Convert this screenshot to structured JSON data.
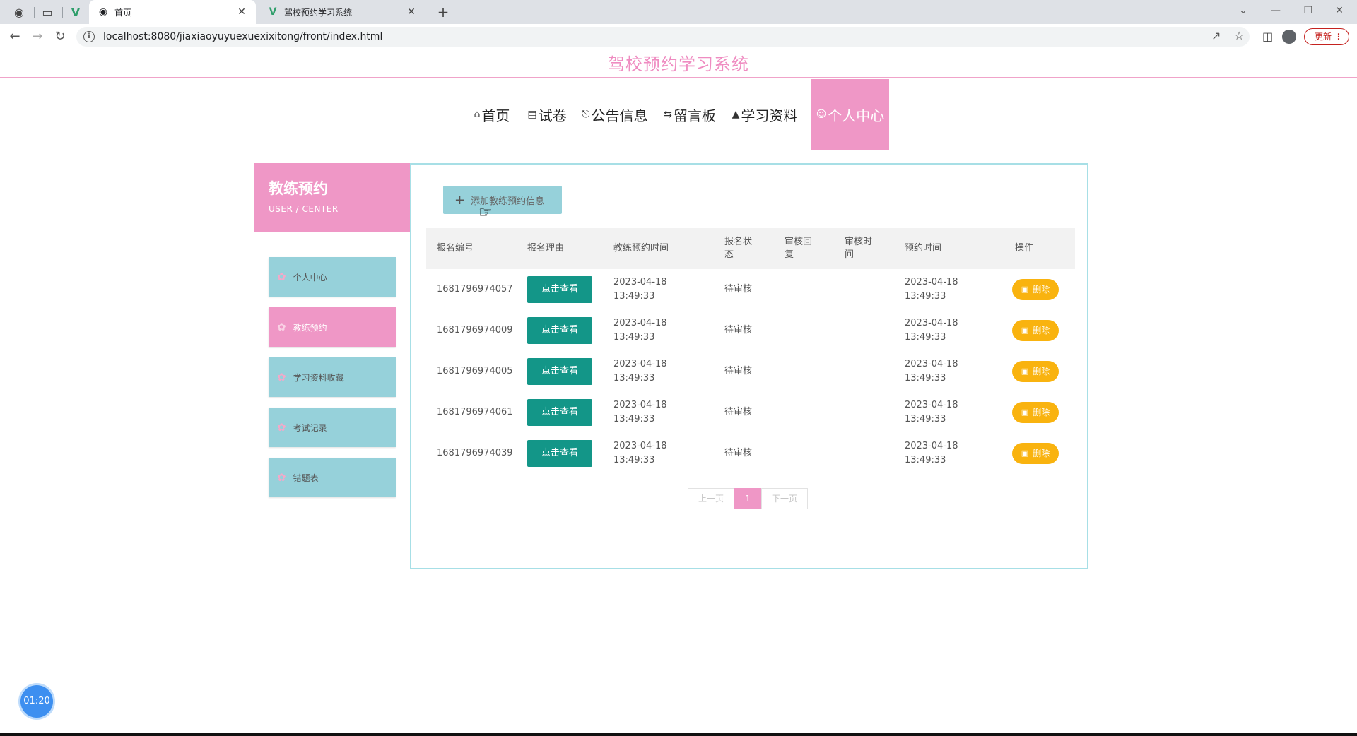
{
  "browser": {
    "tabs": [
      {
        "title": "首页",
        "active": true
      },
      {
        "title": "驾校预约学习系统",
        "active": false
      }
    ],
    "url": "localhost:8080/jiaxiaoyuyuexuexixitong/front/index.html",
    "update_label": "更新"
  },
  "site": {
    "title": "驾校预约学习系统",
    "nav": [
      {
        "label": "首页",
        "icon": "home-icon"
      },
      {
        "label": "试卷",
        "icon": "paper-icon"
      },
      {
        "label": "公告信息",
        "icon": "notice-icon"
      },
      {
        "label": "留言板",
        "icon": "message-board-icon"
      },
      {
        "label": "学习资料",
        "icon": "graduation-cap-icon"
      },
      {
        "label": "个人中心",
        "icon": "user-icon",
        "active": true
      }
    ]
  },
  "sidebar": {
    "title": "教练预约",
    "subtitle": "USER / CENTER",
    "items": [
      {
        "label": "个人中心"
      },
      {
        "label": "教练预约",
        "active": true
      },
      {
        "label": "学习资料收藏"
      },
      {
        "label": "考试记录"
      },
      {
        "label": "错题表"
      }
    ]
  },
  "content": {
    "add_button": "添加教练预约信息",
    "columns": [
      "报名编号",
      "报名理由",
      "教练预约时间",
      "报名状态",
      "审核回复",
      "审核时间",
      "预约时间",
      "操作"
    ],
    "view_label": "点击查看",
    "delete_label": "删除",
    "rows": [
      {
        "id": "1681796974057",
        "coach_date": "2023-04-18",
        "coach_time": "13:49:33",
        "status": "待审核",
        "reply": "",
        "review_time": "",
        "book_date": "2023-04-18",
        "book_time": "13:49:33"
      },
      {
        "id": "1681796974009",
        "coach_date": "2023-04-18",
        "coach_time": "13:49:33",
        "status": "待审核",
        "reply": "",
        "review_time": "",
        "book_date": "2023-04-18",
        "book_time": "13:49:33"
      },
      {
        "id": "1681796974005",
        "coach_date": "2023-04-18",
        "coach_time": "13:49:33",
        "status": "待审核",
        "reply": "",
        "review_time": "",
        "book_date": "2023-04-18",
        "book_time": "13:49:33"
      },
      {
        "id": "1681796974061",
        "coach_date": "2023-04-18",
        "coach_time": "13:49:33",
        "status": "待审核",
        "reply": "",
        "review_time": "",
        "book_date": "2023-04-18",
        "book_time": "13:49:33"
      },
      {
        "id": "1681796974039",
        "coach_date": "2023-04-18",
        "coach_time": "13:49:33",
        "status": "待审核",
        "reply": "",
        "review_time": "",
        "book_date": "2023-04-18",
        "book_time": "13:49:33"
      }
    ],
    "pager": {
      "prev": "上一页",
      "current": "1",
      "next": "下一页"
    }
  },
  "timer": "01:20",
  "colors": {
    "accent_pink": "#ef97c6",
    "accent_teal": "#96d1da",
    "view_green": "#139688",
    "delete_yellow": "#f9b30f"
  }
}
